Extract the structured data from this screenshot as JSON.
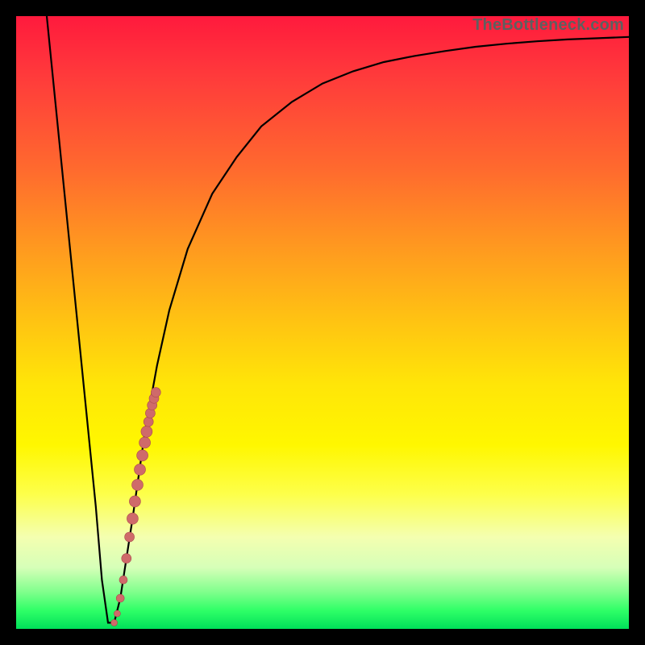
{
  "watermark": "TheBottleneck.com",
  "colors": {
    "frame": "#000000",
    "curve": "#000000",
    "dot_fill": "#cf6a6a",
    "dot_stroke": "#aa4a4a"
  },
  "chart_data": {
    "type": "line",
    "title": "",
    "xlabel": "",
    "ylabel": "",
    "xlim": [
      0,
      100
    ],
    "ylim": [
      0,
      100
    ],
    "series": [
      {
        "name": "bottleneck-curve",
        "x": [
          5,
          7,
          9,
          11,
          13,
          14,
          15,
          16,
          17,
          19,
          21,
          23,
          25,
          28,
          32,
          36,
          40,
          45,
          50,
          55,
          60,
          65,
          70,
          75,
          80,
          85,
          90,
          95,
          100
        ],
        "y": [
          100,
          80,
          60,
          40,
          20,
          8,
          1,
          1,
          5,
          18,
          32,
          43,
          52,
          62,
          71,
          77,
          82,
          86,
          89,
          91,
          92.5,
          93.5,
          94.3,
          95,
          95.5,
          95.9,
          96.2,
          96.4,
          96.6
        ]
      }
    ],
    "markers": {
      "name": "highlight-dots",
      "x": [
        16.0,
        16.5,
        17.0,
        17.5,
        18.0,
        18.5,
        19.0,
        19.4,
        19.8,
        20.2,
        20.6,
        21.0,
        21.3,
        21.6,
        21.9,
        22.2,
        22.5,
        22.8
      ],
      "y": [
        1.0,
        2.5,
        5.0,
        8.0,
        11.5,
        15.0,
        18.0,
        20.8,
        23.5,
        26.0,
        28.3,
        30.4,
        32.2,
        33.8,
        35.2,
        36.5,
        37.6,
        38.6
      ],
      "r": [
        4,
        4,
        5,
        5,
        6,
        6,
        7,
        7,
        7,
        7,
        7,
        7,
        7,
        6,
        6,
        6,
        6,
        6
      ]
    }
  }
}
